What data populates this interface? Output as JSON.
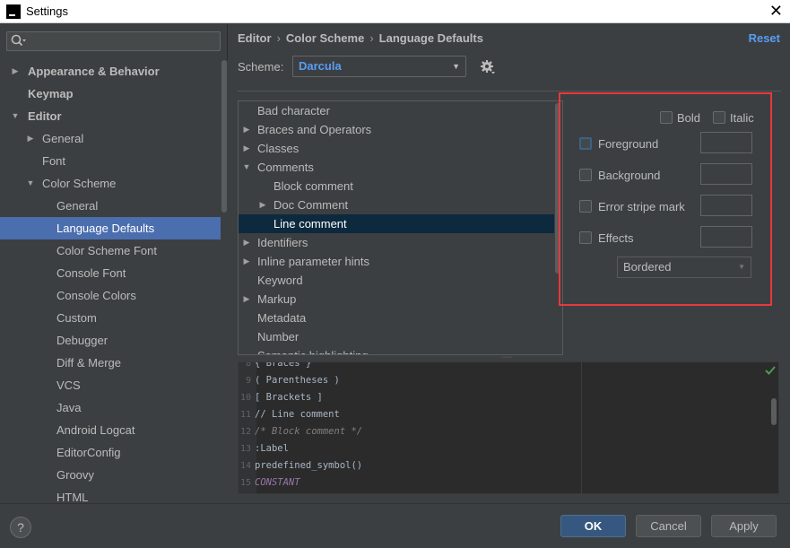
{
  "window": {
    "title": "Settings",
    "close_glyph": "✕"
  },
  "sidebar": {
    "search": {
      "placeholder": "",
      "value": ""
    },
    "items": [
      {
        "label": "Appearance & Behavior",
        "level": 0,
        "arrow": "▶",
        "bold": true
      },
      {
        "label": "Keymap",
        "level": 0,
        "arrow": "",
        "bold": true
      },
      {
        "label": "Editor",
        "level": 0,
        "arrow": "▼",
        "bold": true
      },
      {
        "label": "General",
        "level": 1,
        "arrow": "▶"
      },
      {
        "label": "Font",
        "level": 1,
        "arrow": ""
      },
      {
        "label": "Color Scheme",
        "level": 1,
        "arrow": "▼"
      },
      {
        "label": "General",
        "level": 2,
        "arrow": ""
      },
      {
        "label": "Language Defaults",
        "level": 2,
        "arrow": "",
        "selected": true
      },
      {
        "label": "Color Scheme Font",
        "level": 2,
        "arrow": ""
      },
      {
        "label": "Console Font",
        "level": 2,
        "arrow": ""
      },
      {
        "label": "Console Colors",
        "level": 2,
        "arrow": ""
      },
      {
        "label": "Custom",
        "level": 2,
        "arrow": ""
      },
      {
        "label": "Debugger",
        "level": 2,
        "arrow": ""
      },
      {
        "label": "Diff & Merge",
        "level": 2,
        "arrow": ""
      },
      {
        "label": "VCS",
        "level": 2,
        "arrow": ""
      },
      {
        "label": "Java",
        "level": 2,
        "arrow": ""
      },
      {
        "label": "Android Logcat",
        "level": 2,
        "arrow": ""
      },
      {
        "label": "EditorConfig",
        "level": 2,
        "arrow": ""
      },
      {
        "label": "Groovy",
        "level": 2,
        "arrow": ""
      },
      {
        "label": "HTML",
        "level": 2,
        "arrow": ""
      }
    ]
  },
  "header": {
    "breadcrumb": [
      "Editor",
      "Color Scheme",
      "Language Defaults"
    ],
    "separator": "›",
    "reset_label": "Reset"
  },
  "scheme": {
    "label": "Scheme:",
    "value": "Darcula",
    "dropdown_glyph": "▼"
  },
  "attributes": [
    {
      "label": "Bad character",
      "level": 0,
      "arrow": ""
    },
    {
      "label": "Braces and Operators",
      "level": 0,
      "arrow": "▶"
    },
    {
      "label": "Classes",
      "level": 0,
      "arrow": "▶"
    },
    {
      "label": "Comments",
      "level": 0,
      "arrow": "▼"
    },
    {
      "label": "Block comment",
      "level": 1,
      "arrow": ""
    },
    {
      "label": "Doc Comment",
      "level": 1,
      "arrow": "▶"
    },
    {
      "label": "Line comment",
      "level": 1,
      "arrow": "",
      "selected": true
    },
    {
      "label": "Identifiers",
      "level": 0,
      "arrow": "▶"
    },
    {
      "label": "Inline parameter hints",
      "level": 0,
      "arrow": "▶"
    },
    {
      "label": "Keyword",
      "level": 0,
      "arrow": ""
    },
    {
      "label": "Markup",
      "level": 0,
      "arrow": "▶"
    },
    {
      "label": "Metadata",
      "level": 0,
      "arrow": ""
    },
    {
      "label": "Number",
      "level": 0,
      "arrow": ""
    },
    {
      "label": "Semantic highlighting",
      "level": 0,
      "arrow": ""
    }
  ],
  "properties": {
    "bold_label": "Bold",
    "italic_label": "Italic",
    "foreground_label": "Foreground",
    "background_label": "Background",
    "error_stripe_label": "Error stripe mark",
    "effects_label": "Effects",
    "effect_type": "Bordered",
    "effect_dropdown_glyph": "▼",
    "highlight_color": "#e8383d"
  },
  "preview": {
    "lines": [
      {
        "num": "8",
        "text": "{ Braces }",
        "style": ""
      },
      {
        "num": "9",
        "text": "( Parentheses )",
        "style": ""
      },
      {
        "num": "10",
        "text": "[ Brackets ]",
        "style": ""
      },
      {
        "num": "11",
        "text": "// Line comment",
        "style": "line-comment"
      },
      {
        "num": "12",
        "text": "/* Block comment */",
        "style": "comment"
      },
      {
        "num": "13",
        "text": ":Label",
        "style": ""
      },
      {
        "num": "14",
        "text": "predefined_symbol()",
        "style": ""
      },
      {
        "num": "15",
        "text": "CONSTANT",
        "style": "constant"
      }
    ]
  },
  "footer": {
    "help_label": "?",
    "ok_label": "OK",
    "cancel_label": "Cancel",
    "apply_label": "Apply"
  },
  "colors": {
    "accent": "#589df6",
    "selection": "#4b6eaf",
    "tree_selection": "#0d293e",
    "background": "#3c3f41",
    "editor_background": "#2b2b2b"
  }
}
